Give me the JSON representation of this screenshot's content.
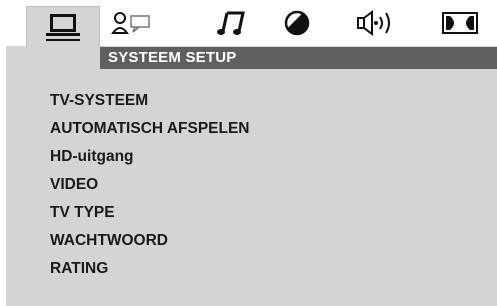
{
  "tabs": [
    {
      "icon": "monitor-icon",
      "active": true
    },
    {
      "icon": "person-speech-icon",
      "active": false
    },
    {
      "icon": "music-note-icon",
      "active": false
    },
    {
      "icon": "contrast-icon",
      "active": false
    },
    {
      "icon": "speaker-icon",
      "active": false
    },
    {
      "icon": "dolby-icon",
      "active": false
    }
  ],
  "header": {
    "title": "SYSTEEM SETUP"
  },
  "menu": {
    "items": [
      "TV-SYSTEEM",
      "AUTOMATISCH AFSPELEN",
      "HD-uitgang",
      "VIDEO",
      "TV TYPE",
      "WACHTWOORD",
      "RATING"
    ]
  },
  "colors": {
    "panel": "#d4d4d4",
    "header": "#5f5f5f",
    "text": "#1a1a1a",
    "header_text": "#ffffff"
  }
}
